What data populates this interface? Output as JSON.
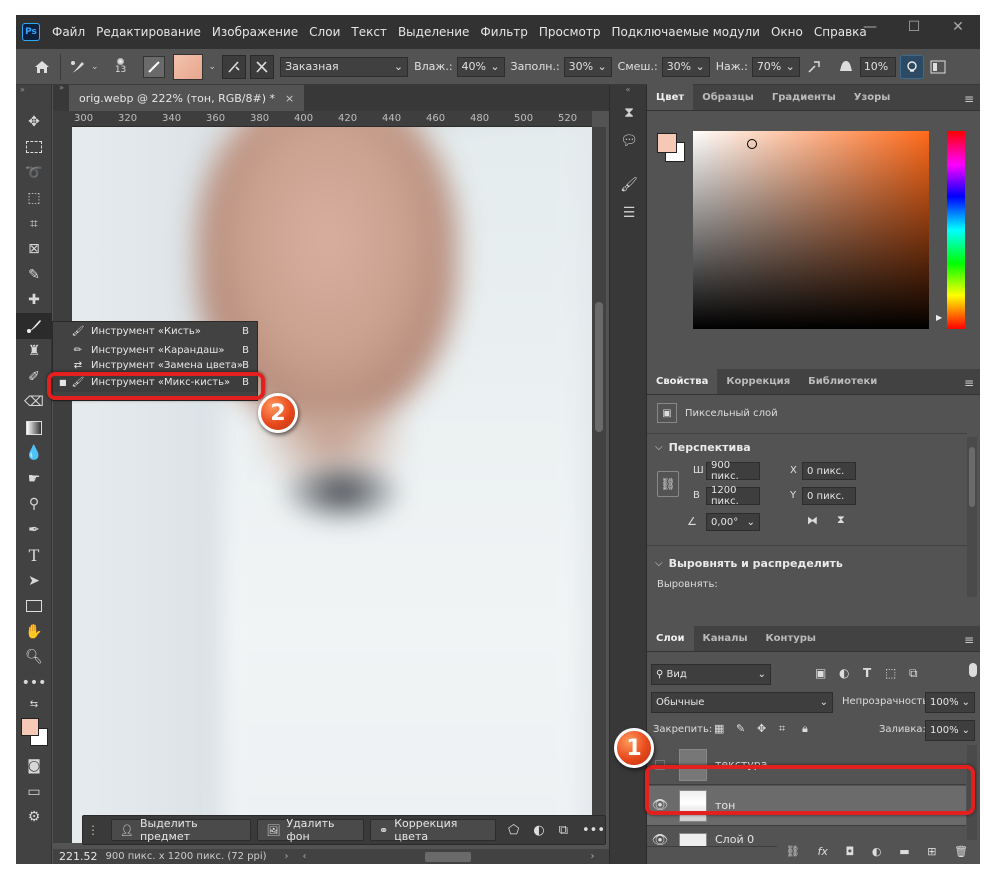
{
  "menu": {
    "logo": "Ps",
    "items": [
      "Файл",
      "Редактирование",
      "Изображение",
      "Слои",
      "Текст",
      "Выделение",
      "Фильтр",
      "Просмотр",
      "Подключаемые модули",
      "Окно",
      "Справка"
    ]
  },
  "options": {
    "brush_size": "13",
    "preset": "Заказная",
    "wet_label": "Влаж.:",
    "wet_value": "40%",
    "load_label": "Заполн.:",
    "load_value": "30%",
    "mix_label": "Смеш.:",
    "mix_value": "30%",
    "flow_label": "Наж.:",
    "flow_value": "70%",
    "angle_value": "10%"
  },
  "document": {
    "tab_title": "orig.webp @ 222% (тон, RGB/8#) *",
    "ruler_ticks": [
      "300",
      "320",
      "340",
      "360",
      "380",
      "400",
      "420",
      "440",
      "460",
      "480",
      "500",
      "520"
    ],
    "zoom": "221.52",
    "doc_info": "900 пикс. x 1200 пикс. (72 ppi)"
  },
  "flyout": {
    "items": [
      {
        "label": "Инструмент «Кисть»",
        "key": "B"
      },
      {
        "label": "Инструмент «Карандаш»",
        "key": "B"
      },
      {
        "label": "Инструмент «Замена цвета»",
        "key": "B"
      },
      {
        "label": "Инструмент «Микс-кисть»",
        "key": "B"
      }
    ]
  },
  "context_bar": {
    "select_subject": "Выделить предмет",
    "remove_bg": "Удалить фон",
    "color_correction": "Коррекция цвета"
  },
  "color_panel": {
    "tabs": [
      "Цвет",
      "Образцы",
      "Градиенты",
      "Узоры"
    ],
    "foreground": "#f6c8b6",
    "background": "#ffffff",
    "hue_color": "#ff6a1a"
  },
  "properties": {
    "tabs": [
      "Свойства",
      "Коррекция",
      "Библиотеки"
    ],
    "layer_type": "Пиксельный слой",
    "perspective_title": "Перспектива",
    "w_label": "Ш",
    "w_value": "900 пикс.",
    "h_label": "В",
    "h_value": "1200 пикс.",
    "x_label": "X",
    "x_value": "0 пикс.",
    "y_label": "Y",
    "y_value": "0 пикс.",
    "angle_value": "0,00°",
    "align_title": "Выровнять и распределить",
    "align_label": "Выровнять:"
  },
  "layers": {
    "tabs": [
      "Слои",
      "Каналы",
      "Контуры"
    ],
    "filter": "Вид",
    "blend_mode": "Обычные",
    "opacity_label": "Непрозрачность:",
    "opacity_value": "100%",
    "lock_label": "Закрепить:",
    "fill_label": "Заливка:",
    "fill_value": "100%",
    "items": [
      {
        "name": "текстура",
        "visible": false
      },
      {
        "name": "тон",
        "visible": true,
        "selected": true
      },
      {
        "name": "Слой 0",
        "visible": true
      }
    ]
  },
  "callouts": {
    "one": "1",
    "two": "2"
  }
}
